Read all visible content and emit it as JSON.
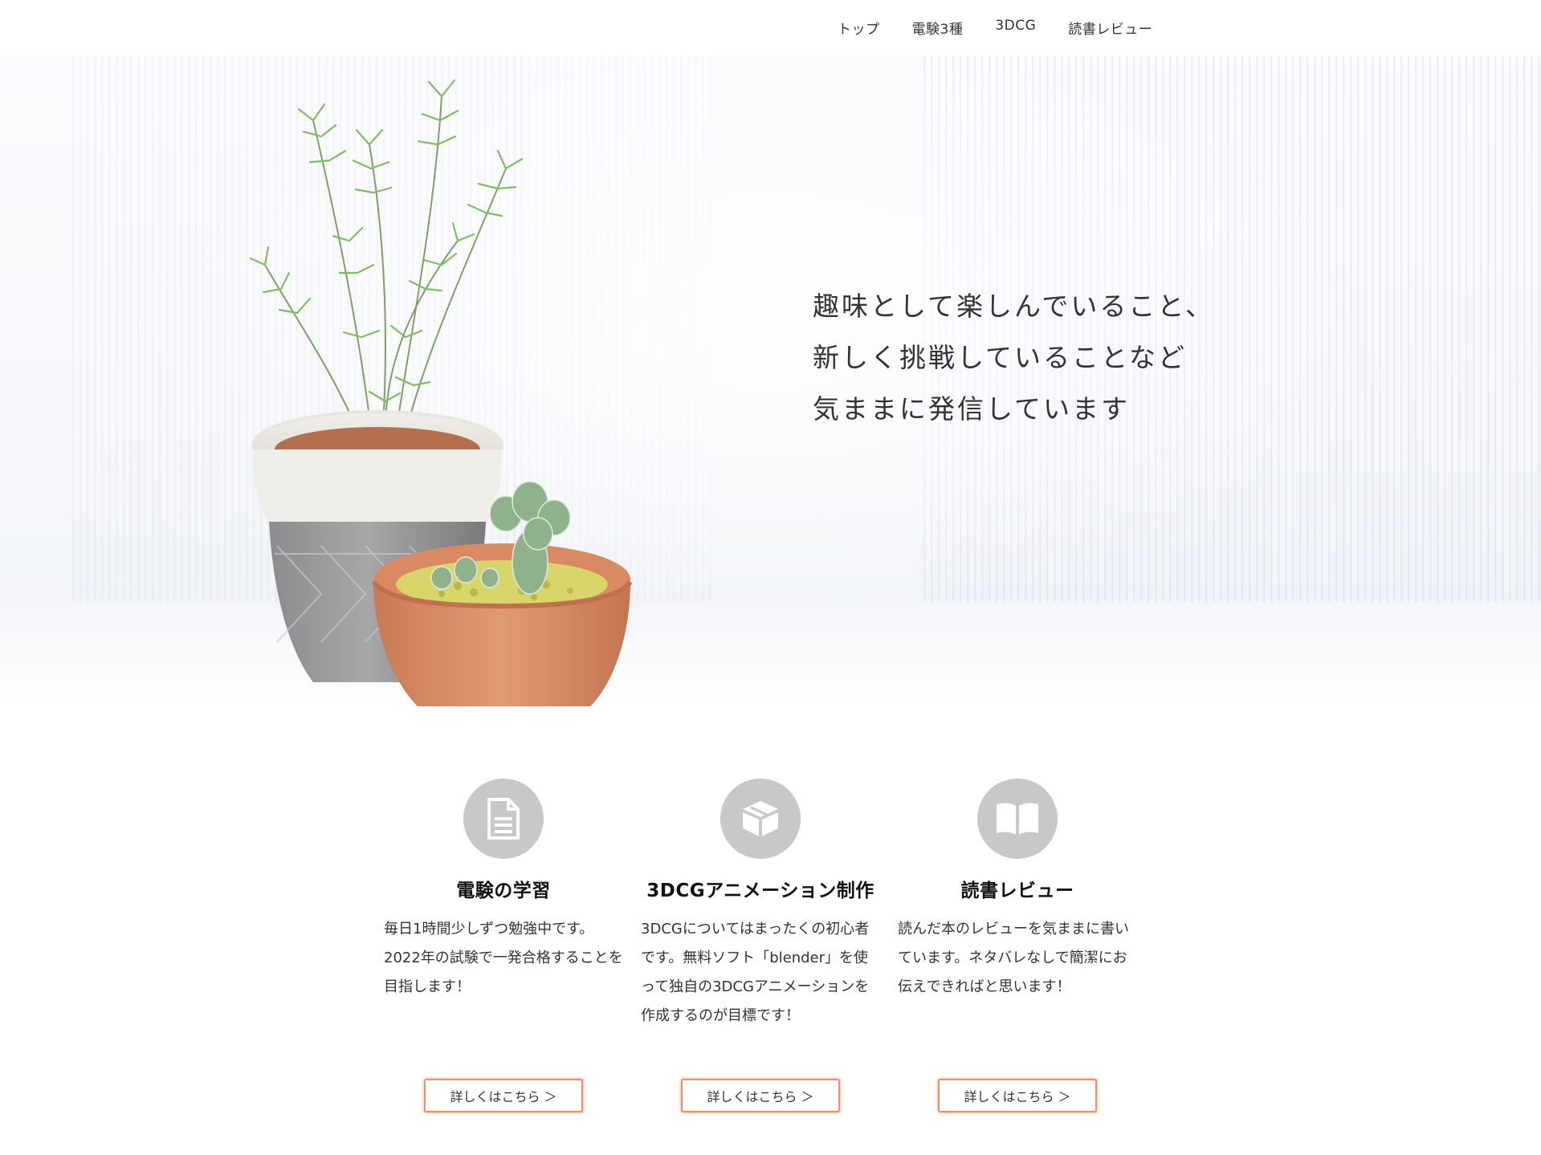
{
  "nav": {
    "items": [
      {
        "label": "トップ"
      },
      {
        "label": "電験3種"
      },
      {
        "label": "3DCG"
      },
      {
        "label": "読書レビュー"
      }
    ]
  },
  "hero": {
    "lines": [
      "趣味として楽しんでいること、",
      "新しく挑戦していることなど",
      "気ままに発信しています"
    ]
  },
  "cards": [
    {
      "icon": "document-icon",
      "title": "電験の学習",
      "desc": "毎日1時間少しずつ勉強中です。2022年の試験で一発合格することを目指します！",
      "button": "詳しくはこちら ＞"
    },
    {
      "icon": "cube-icon",
      "title": "3DCGアニメーション制作",
      "desc": "3DCGについてはまったくの初心者です。無料ソフト「blender」を使って独自の3DCGアニメーションを作成するのが目標です！",
      "button": "詳しくはこちら ＞"
    },
    {
      "icon": "book-icon",
      "title": "読書レビュー",
      "desc": "読んだ本のレビューを気ままに書いています。ネタバレなしで簡潔にお伝えできればと思います！",
      "button": "詳しくはこちら ＞"
    }
  ],
  "colors": {
    "accent": "#f0906a",
    "icon_bg": "#c8c8c8"
  }
}
